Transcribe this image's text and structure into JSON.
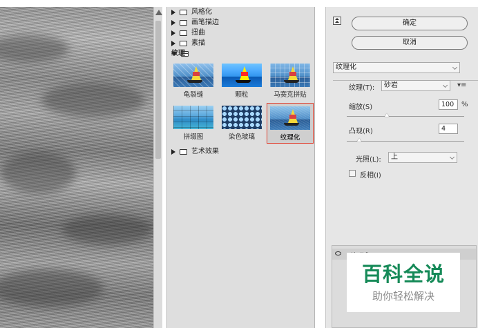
{
  "gallery": {
    "categories_top": [
      {
        "label": "风格化"
      },
      {
        "label": "画笔描边"
      },
      {
        "label": "扭曲"
      },
      {
        "label": "素描"
      }
    ],
    "open_category": {
      "label": "纹理"
    },
    "thumbnails": [
      {
        "label": "龟裂缝"
      },
      {
        "label": "颗粒"
      },
      {
        "label": "马赛克拼贴"
      },
      {
        "label": "拼缀图"
      },
      {
        "label": "染色玻璃"
      },
      {
        "label": "纹理化",
        "selected": true
      }
    ],
    "categories_bottom": [
      {
        "label": "艺术效果"
      }
    ]
  },
  "panel": {
    "ok_label": "确定",
    "cancel_label": "取消",
    "filter_select": "纹理化",
    "texture_label": "纹理(T):",
    "texture_value": "砂岩",
    "scaling_label": "缩放(S)",
    "scaling_value": "100",
    "scaling_unit": "%",
    "relief_label": "凸现(R)",
    "relief_value": "4",
    "light_label": "光照(L):",
    "light_value": "上",
    "invert_label": "反相(I)",
    "layer_name": "纹理化"
  },
  "watermark": {
    "main": "百科全说",
    "sub": "助你轻松解决"
  },
  "colors": {
    "selection_border": "#e0402f",
    "watermark_green": "#168a58"
  }
}
